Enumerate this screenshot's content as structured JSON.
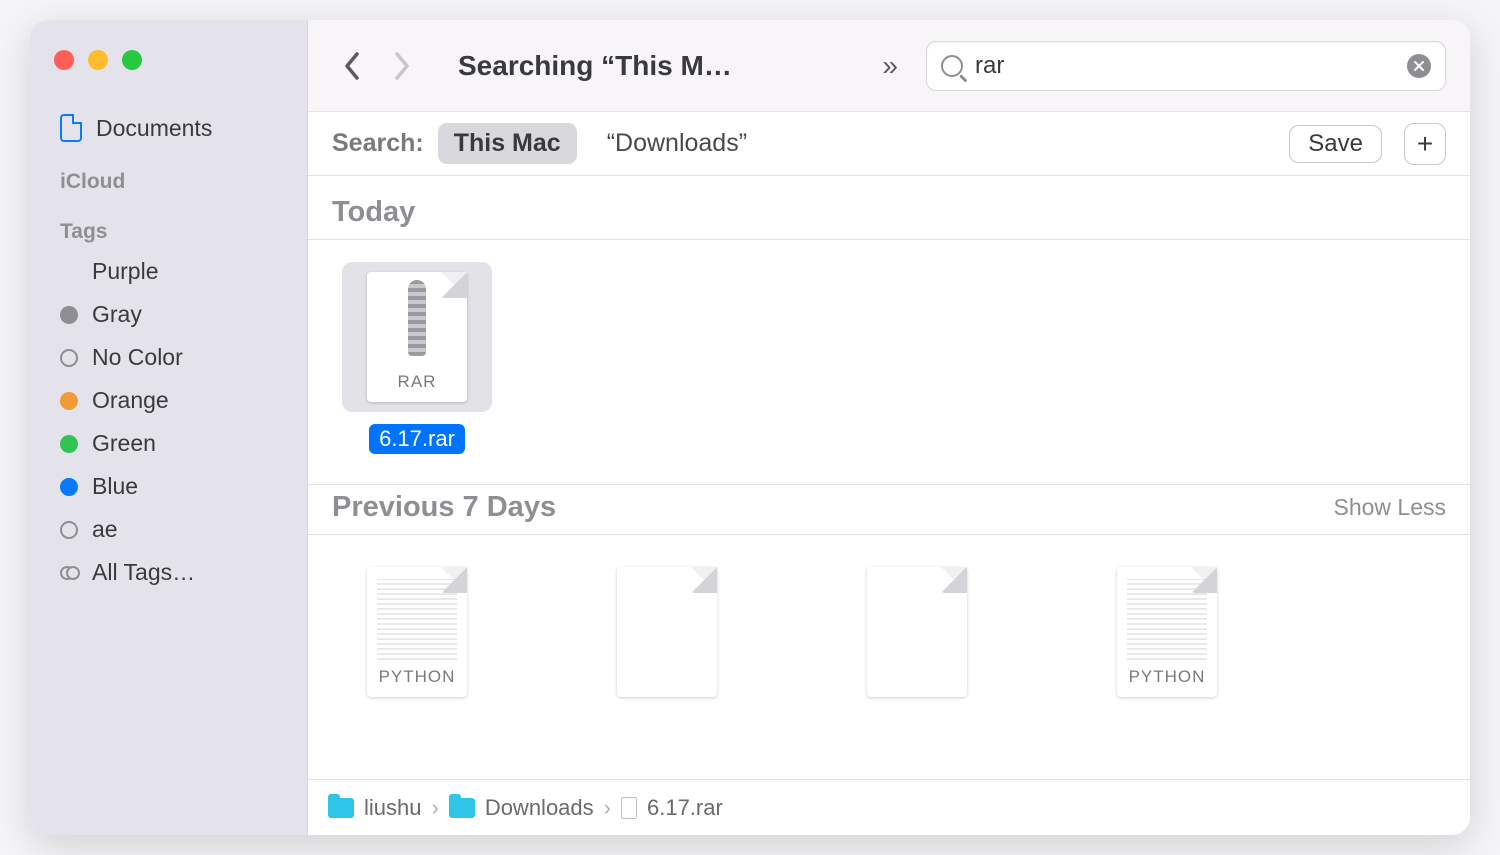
{
  "window_title": "Searching “This M…",
  "sidebar": {
    "items": [
      {
        "label": "Documents",
        "type": "doc"
      }
    ],
    "icloud_heading": "iCloud",
    "tags_heading": "Tags",
    "tags": [
      {
        "label": "Purple",
        "color": "#a550a7",
        "kind": "solid"
      },
      {
        "label": "Gray",
        "color": "#8e8e93",
        "kind": "solid"
      },
      {
        "label": "No Color",
        "color": "",
        "kind": "outline"
      },
      {
        "label": "Orange",
        "color": "#f19a37",
        "kind": "solid"
      },
      {
        "label": "Green",
        "color": "#30c552",
        "kind": "solid"
      },
      {
        "label": "Blue",
        "color": "#057aff",
        "kind": "solid"
      },
      {
        "label": "ae",
        "color": "",
        "kind": "outline"
      },
      {
        "label": "All Tags…",
        "color": "",
        "kind": "all"
      }
    ]
  },
  "toolbar": {
    "search_value": "rar",
    "more_glyph": "»"
  },
  "scope": {
    "label": "Search:",
    "this_mac": "This Mac",
    "downloads": "“Downloads”",
    "save": "Save",
    "plus": "+"
  },
  "sections": {
    "today": {
      "title": "Today",
      "files": [
        {
          "name": "6.17.rar",
          "icon_label": "RAR",
          "style": "zip",
          "selected": true
        }
      ]
    },
    "prev7": {
      "title": "Previous 7 Days",
      "action": "Show Less",
      "files": [
        {
          "name": "",
          "icon_label": "PYTHON",
          "style": "text"
        },
        {
          "name": "",
          "icon_label": "",
          "style": "blank"
        },
        {
          "name": "",
          "icon_label": "",
          "style": "blank"
        },
        {
          "name": "",
          "icon_label": "PYTHON",
          "style": "text"
        }
      ]
    }
  },
  "pathbar": {
    "seg1": "liushu",
    "seg2": "Downloads",
    "seg3": "6.17.rar"
  }
}
